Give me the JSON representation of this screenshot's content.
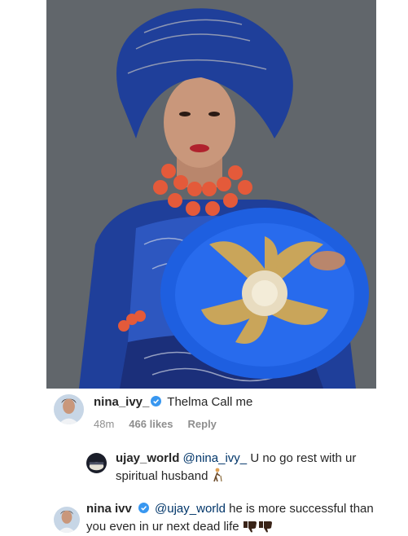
{
  "post": {
    "image_alt": "portrait",
    "accent_blue": "#1a4db0",
    "fan_blue": "#1e5fe0"
  },
  "comments": [
    {
      "username": "nina_ivy_",
      "verified": true,
      "mention": "",
      "text": "Thelma Call me",
      "time": "48m",
      "likes": "466 likes",
      "reply": "Reply"
    },
    {
      "username": "ujay_world",
      "verified": false,
      "mention": "@nina_ivy_",
      "text": "U no go rest with ur spiritual husband",
      "emoji": "person-walking-with-cane-emoji"
    },
    {
      "username": "nina ivv",
      "verified": true,
      "mention": "@ujay_world",
      "text": "he is more successful than you even in ur next dead life",
      "emoji": "thumbs-down-emoji"
    }
  ]
}
